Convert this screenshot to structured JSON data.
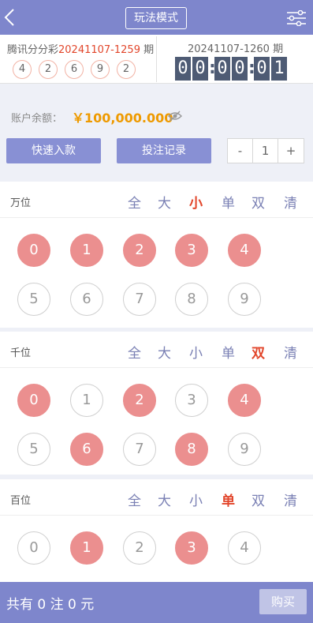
{
  "header": {
    "mode_button": "玩法模式"
  },
  "last_draw": {
    "label_prefix": "腾讯分分彩",
    "issue": "20241107-1259",
    "label_suffix": "期",
    "numbers": [
      "4",
      "2",
      "6",
      "9",
      "2"
    ]
  },
  "current_draw": {
    "issue_label": "20241107-1260 期",
    "countdown": [
      "00",
      "00",
      "01"
    ]
  },
  "account": {
    "balance_label": "账户余额：",
    "balance": "￥100,000.000"
  },
  "actions": {
    "deposit": "快速入款",
    "records": "投注记录",
    "minus": "-",
    "quantity": "1",
    "plus": "+"
  },
  "quick_labels": [
    "全",
    "大",
    "小",
    "单",
    "双",
    "清"
  ],
  "positions": [
    {
      "name": "万位",
      "active_quick": 2,
      "selected": [
        0,
        1,
        2,
        3,
        4
      ],
      "visible_digits": [
        "0",
        "1",
        "2",
        "3",
        "4",
        "5",
        "6",
        "7",
        "8",
        "9"
      ]
    },
    {
      "name": "千位",
      "active_quick": 4,
      "selected": [
        0,
        2,
        4,
        6,
        8
      ],
      "visible_digits": [
        "0",
        "1",
        "2",
        "3",
        "4",
        "5",
        "6",
        "7",
        "8",
        "9"
      ]
    },
    {
      "name": "百位",
      "active_quick": 3,
      "selected": [
        1,
        3
      ],
      "visible_digits": [
        "0",
        "1",
        "2",
        "3",
        "4"
      ]
    }
  ],
  "bottom": {
    "summary": "共有 0 注  0 元",
    "buy": "购买"
  },
  "colors": {
    "accent": "#7e86cc",
    "selected_ball": "#eb8f8f",
    "highlight": "#e2462b",
    "balance": "#ee9a00"
  }
}
